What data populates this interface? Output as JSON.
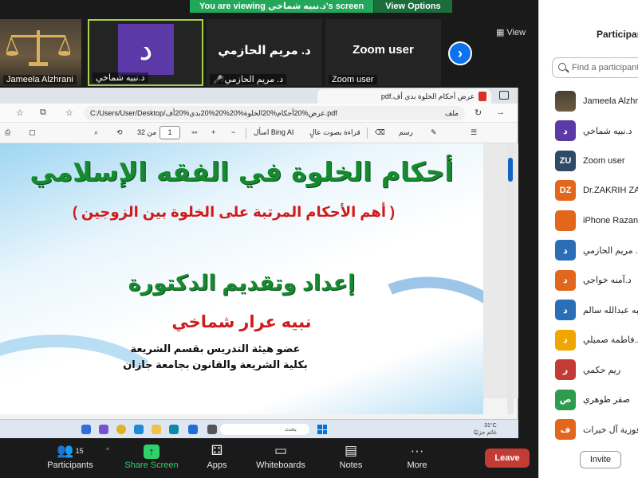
{
  "banner": {
    "message": "You are viewing د.نبيه شماخي's screen",
    "view_options": "View Options"
  },
  "strip": {
    "tiles": [
      {
        "name": "Jameela Alzhrani"
      },
      {
        "initial": "د",
        "name": "د.نبيه شماخي"
      },
      {
        "big": "د. مريم الحازمي",
        "name": "د. مريم الحازمي"
      },
      {
        "big": "Zoom user",
        "name": "Zoom user"
      }
    ],
    "view_label": "View"
  },
  "browser": {
    "tab_title": "عرض أحكام الخلوة بدي أف.pdf",
    "address": "C:/Users/User/Desktop/عرض%20أحكام%20الخلوة%20%20%20بدي%20أف.pdf",
    "address_label": "ملف",
    "toolbar": {
      "draw": "رسم",
      "read_aloud": "قراءة بصوت عالٍ",
      "ask_bing": "اسأل Bing AI",
      "page_current": "1",
      "page_total": "من 32"
    }
  },
  "slide": {
    "title": "أحكام الخلوة في الفقه الإسلامي",
    "subtitle": "( أهم الأحكام المرتبة على الخلوة بين الزوجين )",
    "prepared_by": "إعداد وتقديم الدكتورة",
    "author": "نبيه عرار شماخي",
    "line1": "عضو هيئة التدريس بقسم الشريعة",
    "line2": "بكلية الشريعة والقانون بجامعة جازان"
  },
  "taskbar": {
    "search_placeholder": "بحث",
    "weather_temp": "31°C",
    "weather_text": "غائم جزئيًا"
  },
  "zoom_toolbar": {
    "participants": "Participants",
    "participants_count": "15",
    "share_screen": "Share Screen",
    "apps": "Apps",
    "whiteboards": "Whiteboards",
    "notes": "Notes",
    "more": "More",
    "leave": "Leave"
  },
  "panel": {
    "title": "Participants",
    "search_placeholder": "Find a participant",
    "participants": [
      {
        "initials": "",
        "name": "Jameela Alzhrani",
        "color": "#6b5a41"
      },
      {
        "initials": "د",
        "name": "د.نبيه شماخي",
        "color": "#5b3aa8"
      },
      {
        "initials": "ZU",
        "name": "Zoom user",
        "color": "#2e4a66"
      },
      {
        "initials": "DZ",
        "name": "Dr.ZAKRIH ZA",
        "color": "#e2661b"
      },
      {
        "initials": "",
        "name": "iPhone Razan",
        "color": "#e2661b"
      },
      {
        "initials": "د",
        "name": "د. مريم الحازمي",
        "color": "#2a6fb5"
      },
      {
        "initials": "د",
        "name": "د.آمنه خواجي",
        "color": "#e2661b"
      },
      {
        "initials": "د",
        "name": "د.هبه عبدالله سالم",
        "color": "#2a6fb5"
      },
      {
        "initials": "د",
        "name": "د.فاطمة صميلي",
        "color": "#f0a500"
      },
      {
        "initials": "ر",
        "name": "ريم حكمي",
        "color": "#c23b34"
      },
      {
        "initials": "ص",
        "name": "صقر طوهري",
        "color": "#2e9b4f"
      },
      {
        "initials": "ف",
        "name": "د.فوزية آل خيرات",
        "color": "#e2661b"
      }
    ],
    "invite": "Invite"
  }
}
